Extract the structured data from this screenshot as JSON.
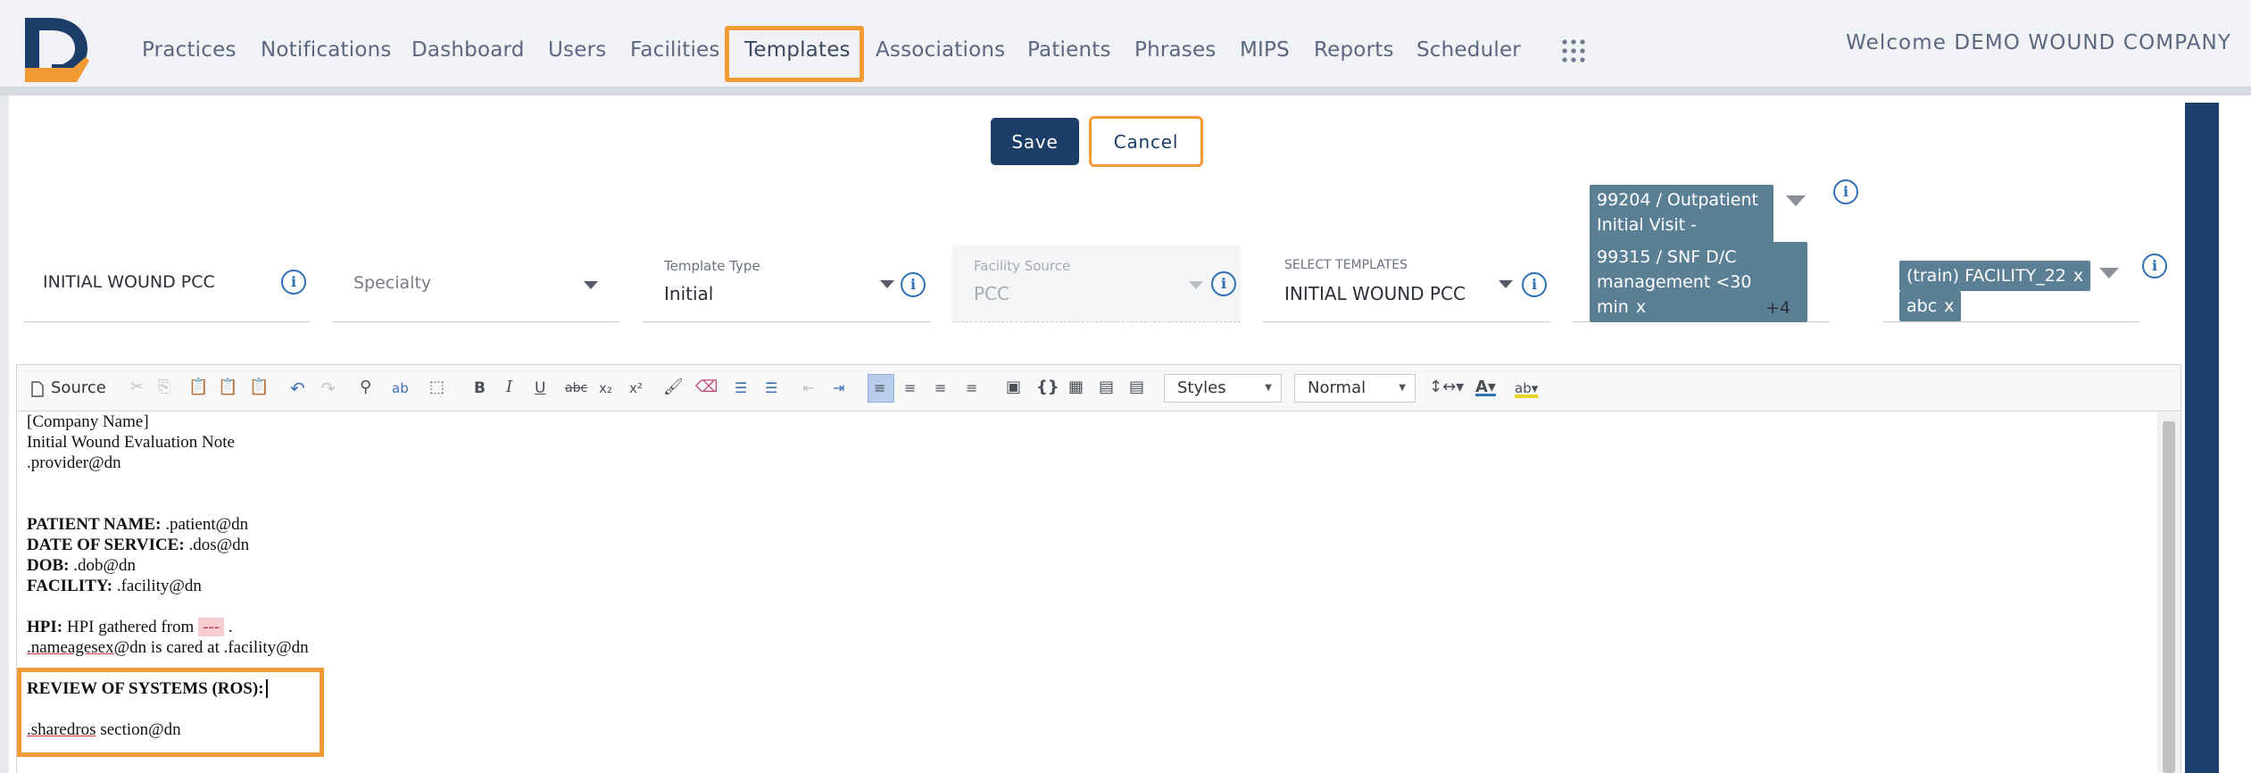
{
  "nav": {
    "items": [
      "Practices",
      "Notifications",
      "Dashboard",
      "Users",
      "Facilities",
      "Templates",
      "Associations",
      "Patients",
      "Phrases",
      "MIPS",
      "Reports",
      "Scheduler"
    ],
    "active": "Templates",
    "welcome": "Welcome DEMO WOUND COMPANY"
  },
  "actions": {
    "save": "Save",
    "cancel": "Cancel"
  },
  "form": {
    "template_name": "INITIAL WOUND PCC",
    "specialty_placeholder": "Specialty",
    "template_type_label": "Template Type",
    "template_type_value": "Initial",
    "facility_source_label": "Facility Source",
    "facility_source_value": "PCC",
    "select_templates_label": "SELECT TEMPLATES",
    "select_templates_value": "INITIAL WOUND PCC",
    "cpt_chips": [
      {
        "line1": "99204 / Outpatient",
        "line2": "Initial Visit - Mod..."
      },
      {
        "line1": "99315 / SNF D/C",
        "line2": "management <30 min"
      }
    ],
    "cpt_more": "+4",
    "facility_chips": [
      "(train) FACILITY_22",
      "abc"
    ],
    "chip_remove": "x",
    "info": "i"
  },
  "editor": {
    "source_label": "Source",
    "styles_label": "Styles",
    "format_label": "Normal",
    "lines": {
      "company": "[Company Name]",
      "note_title": "Initial Wound Evaluation Note",
      "provider": ".provider@dn",
      "patient_label": "PATIENT NAME:",
      "patient_value": " .patient@dn",
      "dos_label": "DATE OF SERVICE:",
      "dos_value": " .dos@dn",
      "dob_label": "DOB:",
      "dob_value": " .dob@dn",
      "facility_label": "FACILITY:",
      "facility_value": " .facility@dn",
      "hpi_label": "HPI:",
      "hpi_value": " HPI gathered from ",
      "hpi_placeholder": "---",
      "hpi_end": " .",
      "nameagesex": ".nameagesex",
      "cared_at": "@dn is cared at .facility@dn",
      "ros_heading": "REVIEW OF SYSTEMS (ROS):",
      "sharedros": ".sharedros",
      "sharedros_rest": " section@dn"
    }
  }
}
